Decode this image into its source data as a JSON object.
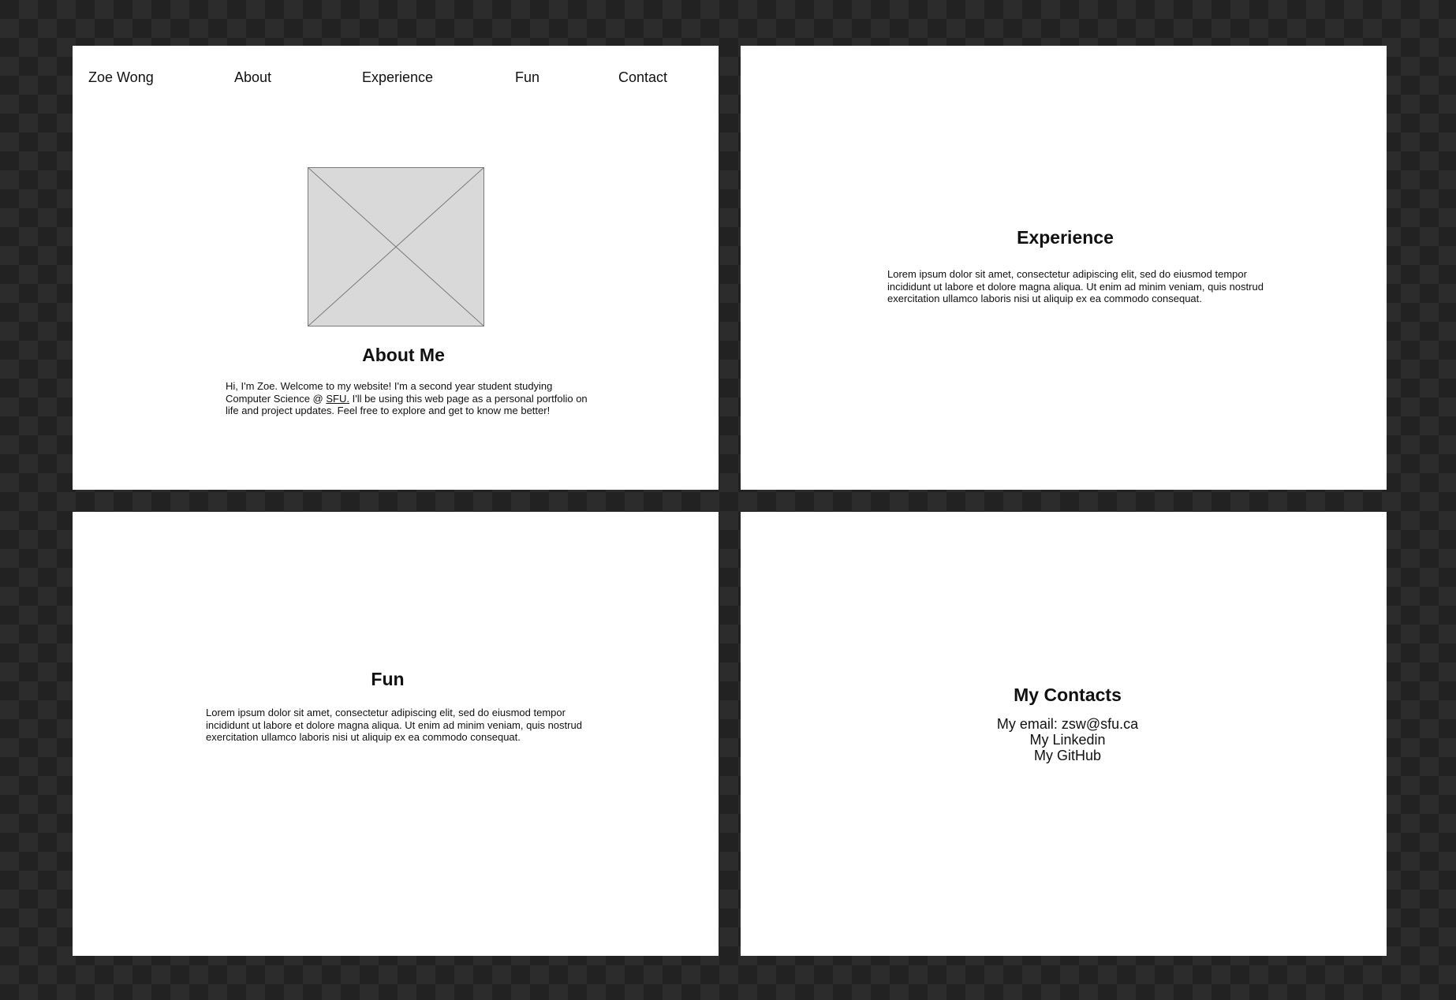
{
  "nav": {
    "name": "Zoe Wong",
    "about": "About",
    "experience": "Experience",
    "fun": "Fun",
    "contact": "Contact"
  },
  "about": {
    "heading": "About Me",
    "text_before_link": "Hi, I'm Zoe. Welcome to my website! I'm a second year student studying Computer Science @ ",
    "link": "SFU.",
    "text_after_link": " I'll be using this web page as a personal portfolio on life and project updates. Feel free to explore and get to know me better!"
  },
  "experience": {
    "heading": "Experience",
    "text": "Lorem ipsum dolor sit amet, consectetur adipiscing elit, sed do eiusmod tempor incididunt ut labore et dolore magna aliqua. Ut enim ad minim veniam, quis nostrud exercitation ullamco laboris nisi ut aliquip ex ea commodo consequat."
  },
  "fun": {
    "heading": "Fun",
    "text": "Lorem ipsum dolor sit amet, consectetur adipiscing elit, sed do eiusmod tempor incididunt ut labore et dolore magna aliqua. Ut enim ad minim veniam, quis nostrud exercitation ullamco laboris nisi ut aliquip ex ea commodo consequat."
  },
  "contact": {
    "heading": "My Contacts",
    "email": "My email: zsw@sfu.ca",
    "linkedin": "My Linkedin",
    "github": "My GitHub"
  },
  "colors": {
    "canvas_dark": "#222222",
    "canvas_checker": "#2c2c2c",
    "frame": "#ffffff",
    "placeholder_fill": "#d9d9d9",
    "placeholder_stroke": "#7a7a7a"
  },
  "icons": {
    "image_placeholder": "image-placeholder-icon"
  }
}
